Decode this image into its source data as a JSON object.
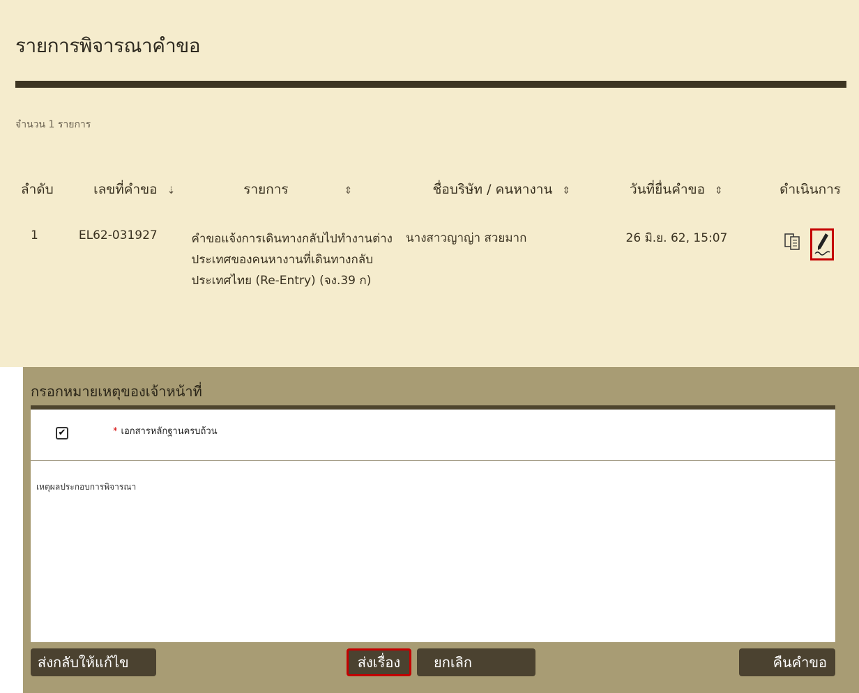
{
  "page_title": "รายการพิจารณาคำขอ",
  "record_count": "จำนวน 1 รายการ",
  "table": {
    "headers": [
      "ลำดับ",
      "เลขที่คำขอ",
      "รายการ",
      "ชื่อบริษัท / คนหางาน",
      "วันที่ยื่นคำขอ",
      "ดำเนินการ"
    ],
    "rows": [
      {
        "no": "1",
        "request_no": "EL62-031927",
        "item": "คำขอแจ้งการเดินทางกลับไปทำงานต่างประเทศของคนหางานที่เดินทางกลับประเทศไทย (Re-Entry) (จง.39 ก)",
        "name": "นางสาวญาญ่า สวยมาก",
        "date": "26 มิ.ย. 62, 15:07"
      }
    ]
  },
  "officer_note": {
    "title": "กรอกหมายเหตุของเจ้าหน้าที่",
    "checkbox_label": "เอกสารหลักฐานครบถ้วน",
    "checkbox_checked": true,
    "reason_label": "เหตุผลประกอบการพิจารณา"
  },
  "buttons": {
    "return": "ส่งกลับให้แก้ไข",
    "send": "ส่งเรื่อง",
    "cancel": "ยกเลิก",
    "withdraw": "คืนคำขอ"
  },
  "colors": {
    "top_background": "#f5eccd",
    "panel_background": "#a89c74",
    "button": "#4b4230",
    "highlight": "#c40000"
  }
}
